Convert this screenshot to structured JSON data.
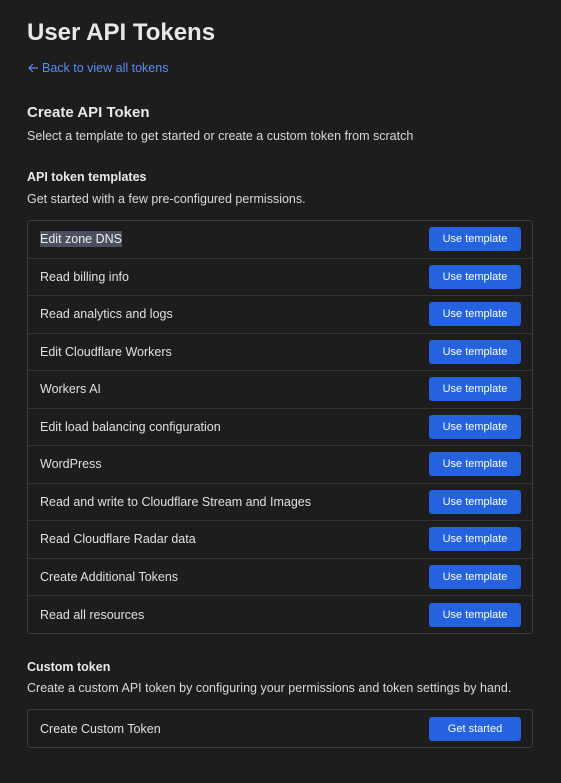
{
  "header": {
    "title": "User API Tokens",
    "back_link": "Back to view all tokens"
  },
  "create_section": {
    "title": "Create API Token",
    "description": "Select a template to get started or create a custom token from scratch"
  },
  "templates_section": {
    "title": "API token templates",
    "description": "Get started with a few pre-configured permissions.",
    "button_label": "Use template",
    "items": [
      {
        "label": "Edit zone DNS",
        "selected": true
      },
      {
        "label": "Read billing info"
      },
      {
        "label": "Read analytics and logs"
      },
      {
        "label": "Edit Cloudflare Workers"
      },
      {
        "label": "Workers AI"
      },
      {
        "label": "Edit load balancing configuration"
      },
      {
        "label": "WordPress"
      },
      {
        "label": "Read and write to Cloudflare Stream and Images"
      },
      {
        "label": "Read Cloudflare Radar data"
      },
      {
        "label": "Create Additional Tokens"
      },
      {
        "label": "Read all resources"
      }
    ]
  },
  "custom_section": {
    "title": "Custom token",
    "description": "Create a custom API token by configuring your permissions and token settings by hand.",
    "item_label": "Create Custom Token",
    "button_label": "Get started"
  },
  "colors": {
    "background": "#1d1d1d",
    "accent": "#2462e0",
    "link": "#5b8cf0",
    "border": "#3b3b3b"
  }
}
